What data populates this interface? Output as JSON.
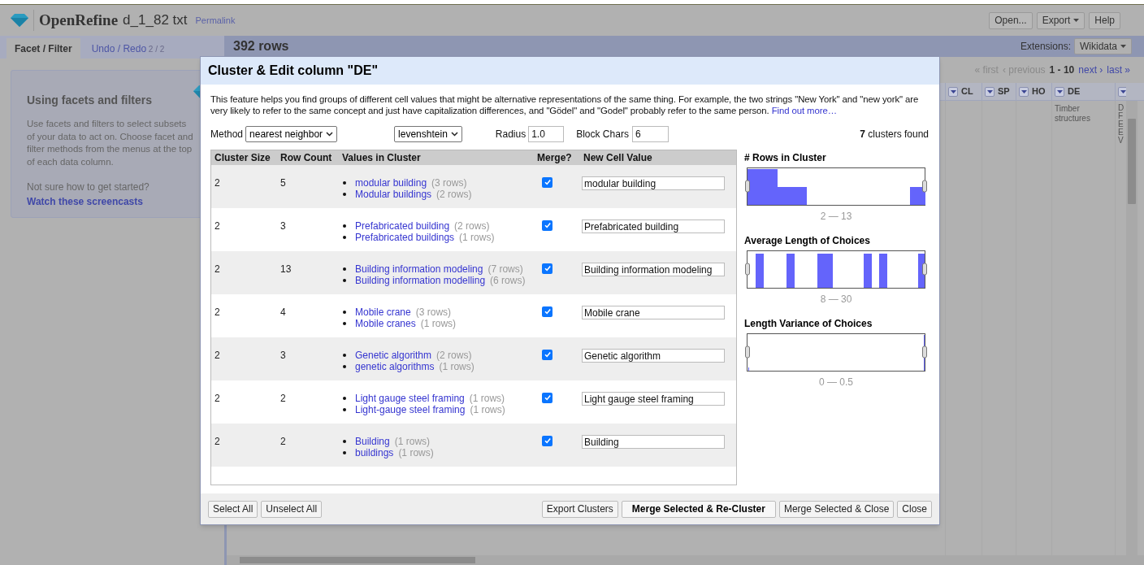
{
  "app": {
    "name": "OpenRefine",
    "project": "d_1_82 txt",
    "permalink": "Permalink",
    "buttons": [
      {
        "label": "Open...",
        "menu": false
      },
      {
        "label": "Export",
        "menu": true
      },
      {
        "label": "Help",
        "menu": false
      }
    ]
  },
  "left_panel": {
    "tabs": [
      {
        "label": "Facet / Filter",
        "selected": true
      },
      {
        "label": "Undo / Redo",
        "count": "2 / 2",
        "selected": false
      }
    ],
    "help": {
      "title": "Using facets and filters",
      "body": "Use facets and filters to select subsets of your data to act on. Choose facet and filter methods from the menus at the top of each data column.",
      "question": "Not sure how to get started?",
      "link": "Watch these screencasts"
    }
  },
  "grid": {
    "row_count": "392 rows",
    "extensions_label": "Extensions:",
    "extensions_menu": "Wikidata",
    "pager": [
      {
        "label": "« first",
        "kind": "link",
        "disabled": true
      },
      {
        "label": "‹ previous",
        "kind": "link",
        "disabled": true
      },
      {
        "label": "1 - 10",
        "kind": "range"
      },
      {
        "label": "next ›",
        "kind": "link",
        "disabled": false
      },
      {
        "label": "last »",
        "kind": "link",
        "disabled": false
      }
    ],
    "columns": [
      {
        "name": "CL"
      },
      {
        "name": "SP"
      },
      {
        "name": "HO"
      },
      {
        "name": "DE",
        "cell": "Timber structures"
      },
      {
        "cell_lines": [
          "D",
          "F",
          "E",
          "E",
          "V"
        ]
      }
    ]
  },
  "dialog": {
    "title": "Cluster & Edit column \"DE\"",
    "description": "This feature helps you find groups of different cell values that might be alternative representations of the same thing. For example, the two strings \"New York\" and \"new york\" are very likely to refer to the same concept and just have capitalization differences, and \"Gödel\" and \"Godel\" probably refer to the same person.",
    "link": "Find out more…",
    "method_label": "Method",
    "method": "nearest neighbor",
    "function": "levenshtein",
    "radius_label": "Radius",
    "radius": "1.0",
    "block_label": "Block Chars",
    "block": "6",
    "found": "**7** clusters found",
    "columns": [
      "Cluster Size",
      "Row Count",
      "Values in Cluster",
      "Merge?",
      "New Cell Value"
    ],
    "clusters": [
      {
        "size": "2",
        "row_count": "5",
        "values": [
          {
            "value": "modular building",
            "rows": "(3 rows)"
          },
          {
            "value": "Modular buildings",
            "rows": "(2 rows)"
          }
        ],
        "merge": true,
        "new_value": "modular building"
      },
      {
        "size": "2",
        "row_count": "3",
        "values": [
          {
            "value": "Prefabricated building",
            "rows": "(2 rows)"
          },
          {
            "value": "Prefabricated buildings",
            "rows": "(1 rows)"
          }
        ],
        "merge": true,
        "new_value": "Prefabricated building"
      },
      {
        "size": "2",
        "row_count": "13",
        "values": [
          {
            "value": "Building information modeling",
            "rows": "(7 rows)"
          },
          {
            "value": "Building information modelling",
            "rows": "(6 rows)"
          }
        ],
        "merge": true,
        "new_value": "Building information modeling"
      },
      {
        "size": "2",
        "row_count": "4",
        "values": [
          {
            "value": "Mobile crane",
            "rows": "(3 rows)"
          },
          {
            "value": "Mobile cranes",
            "rows": "(1 rows)"
          }
        ],
        "merge": true,
        "new_value": "Mobile crane"
      },
      {
        "size": "2",
        "row_count": "3",
        "values": [
          {
            "value": "Genetic algorithm",
            "rows": "(2 rows)"
          },
          {
            "value": "genetic algorithms",
            "rows": "(1 rows)"
          }
        ],
        "merge": true,
        "new_value": "Genetic algorithm"
      },
      {
        "size": "2",
        "row_count": "2",
        "values": [
          {
            "value": "Light gauge steel framing",
            "rows": "(1 rows)"
          },
          {
            "value": "Light-gauge steel framing",
            "rows": "(1 rows)"
          }
        ],
        "merge": true,
        "new_value": "Light gauge steel framing"
      },
      {
        "size": "2",
        "row_count": "2",
        "values": [
          {
            "value": "Building",
            "rows": "(1 rows)"
          },
          {
            "value": "buildings",
            "rows": "(1 rows)"
          }
        ],
        "merge": true,
        "new_value": "Building"
      }
    ],
    "histograms": [
      {
        "title": "# Rows in Cluster",
        "range": "2 — 13"
      },
      {
        "title": "Average Length of Choices",
        "range": "8 — 30"
      },
      {
        "title": "Length Variance of Choices",
        "range": "0 — 0.5"
      }
    ],
    "left_buttons": [
      {
        "label": "Select All",
        "primary": false
      },
      {
        "label": "Unselect All",
        "primary": false
      }
    ],
    "right_buttons": [
      {
        "label": "Export Clusters",
        "primary": false
      },
      {
        "label": "Merge Selected & Re-Cluster",
        "primary": true
      },
      {
        "label": "Merge Selected & Close",
        "primary": false
      },
      {
        "label": "Close",
        "primary": false
      }
    ]
  }
}
